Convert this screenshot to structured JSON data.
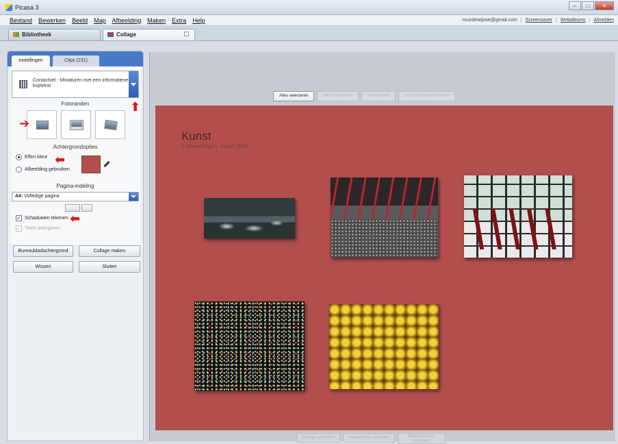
{
  "window": {
    "title": "Picasa 3",
    "controls": [
      "–",
      "□",
      "✕"
    ]
  },
  "menu": [
    "Bestand",
    "Bewerken",
    "Beeld",
    "Map",
    "Afbeelding",
    "Maken",
    "Extra",
    "Help"
  ],
  "account": {
    "email": "musslewijnse@gmail.com",
    "links": [
      "Screensaver",
      "Webalbums",
      "Afmelden"
    ]
  },
  "tabs": {
    "library": "Bibliotheek",
    "collage": "Collage"
  },
  "sidebar": {
    "tabs": {
      "settings": "Instellingen",
      "clips": "Clips (231)"
    },
    "layout": {
      "label": "Contactvel - Miniaturen met een informatieve koptekst"
    },
    "frames_title": "Fotoranden",
    "background_title": "Achtergrondopties",
    "solid_color_label": "Effen kleur",
    "use_image_label": "Afbeelding gebruiken",
    "background_color": "#b24f4d",
    "page_title": "Pagina-indeling",
    "page_select": {
      "prefix": "A4:",
      "value": "Volledige pagina"
    },
    "shadows_label": "Schaduwen tekenen",
    "captions_label": "Titels weergeven",
    "buttons": {
      "desktop": "Bureaubladachtergrond",
      "make": "Collage maken",
      "clear": "Wissen",
      "close": "Sluiten"
    }
  },
  "toolbar": {
    "select_all": "Alles selecteren",
    "clear_selection": "Niets selecteren",
    "shuffle": "Verwijderen",
    "as_background": "Als achtergrond instellen"
  },
  "collage": {
    "title": "Kunst",
    "subtitle": "5 afbeeldingen, maart 2009"
  },
  "bottom_toolbar": {
    "b1": "Collage schudden",
    "b2": "Afbeeldingen wisselen",
    "b3": "Weergeven en bewerken"
  }
}
